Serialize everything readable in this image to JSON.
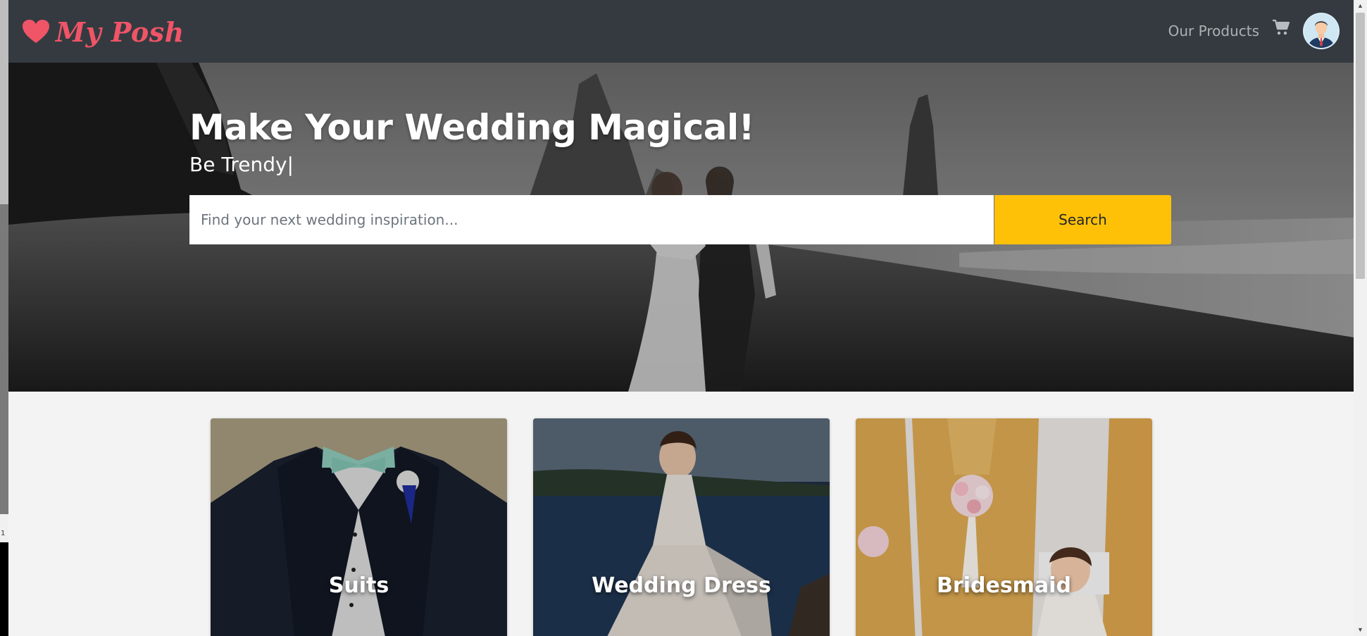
{
  "navbar": {
    "brand": "My Posh",
    "nav_link": "Our Products",
    "cart_icon": "cart-icon",
    "avatar_icon": "user-avatar"
  },
  "hero": {
    "title": "Make Your Wedding Magical!",
    "subtitle": "Be Trendy|",
    "search_placeholder": "Find your next wedding inspiration...",
    "search_value": "",
    "search_button": "Search"
  },
  "categories": [
    {
      "label": "Suits"
    },
    {
      "label": "Wedding Dress"
    },
    {
      "label": "Bridesmaid"
    }
  ],
  "left_edge_text": "1",
  "colors": {
    "navbar_bg": "#343a40",
    "brand": "#ef5467",
    "search_button": "#ffc107",
    "page_bg": "#f3f3f3"
  }
}
